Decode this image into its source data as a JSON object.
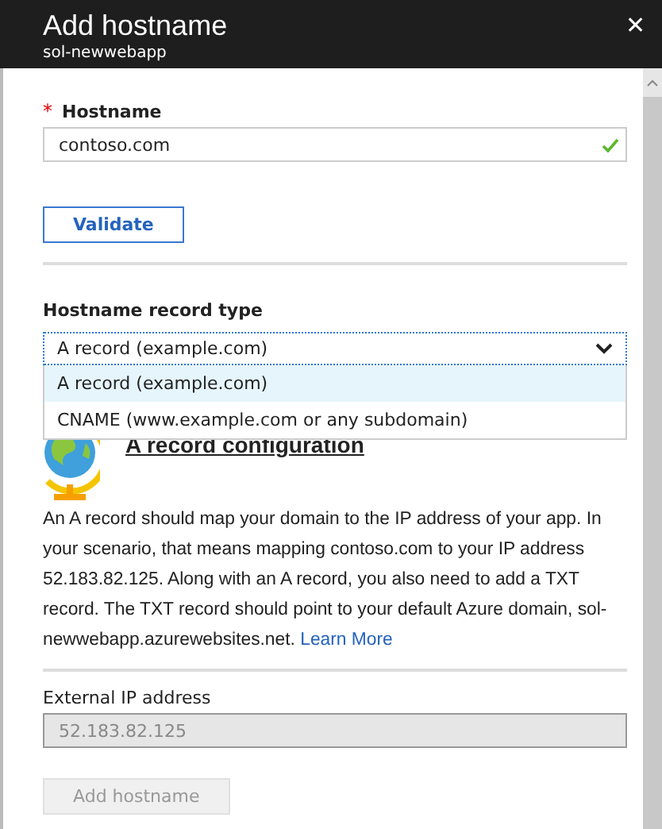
{
  "header": {
    "title": "Add hostname",
    "subtitle": "sol-newwebapp",
    "close": "✕"
  },
  "hostname": {
    "required_mark": "*",
    "label": "Hostname",
    "value": "contoso.com",
    "valid": true
  },
  "validate_button": "Validate",
  "record_type": {
    "label": "Hostname record type",
    "value": "A record (example.com)",
    "expanded": true,
    "options": [
      {
        "label": "A record (example.com)",
        "selected": true
      },
      {
        "label": "CNAME (www.example.com or any subdomain)",
        "selected": false
      }
    ]
  },
  "config": {
    "heading": "A record configuration",
    "description": "An A record should map your domain to the IP address of your app. In your scenario, that means mapping contoso.com to your IP address 52.183.82.125. Along with an A record, you also need to add a TXT record. The TXT record should point to your default Azure domain, sol-newwebapp.azurewebsites.net.",
    "link": "Learn More"
  },
  "external_ip": {
    "label": "External IP address",
    "value": "52.183.82.125",
    "disabled": true
  },
  "add_button": {
    "label": "Add hostname",
    "disabled": true
  }
}
